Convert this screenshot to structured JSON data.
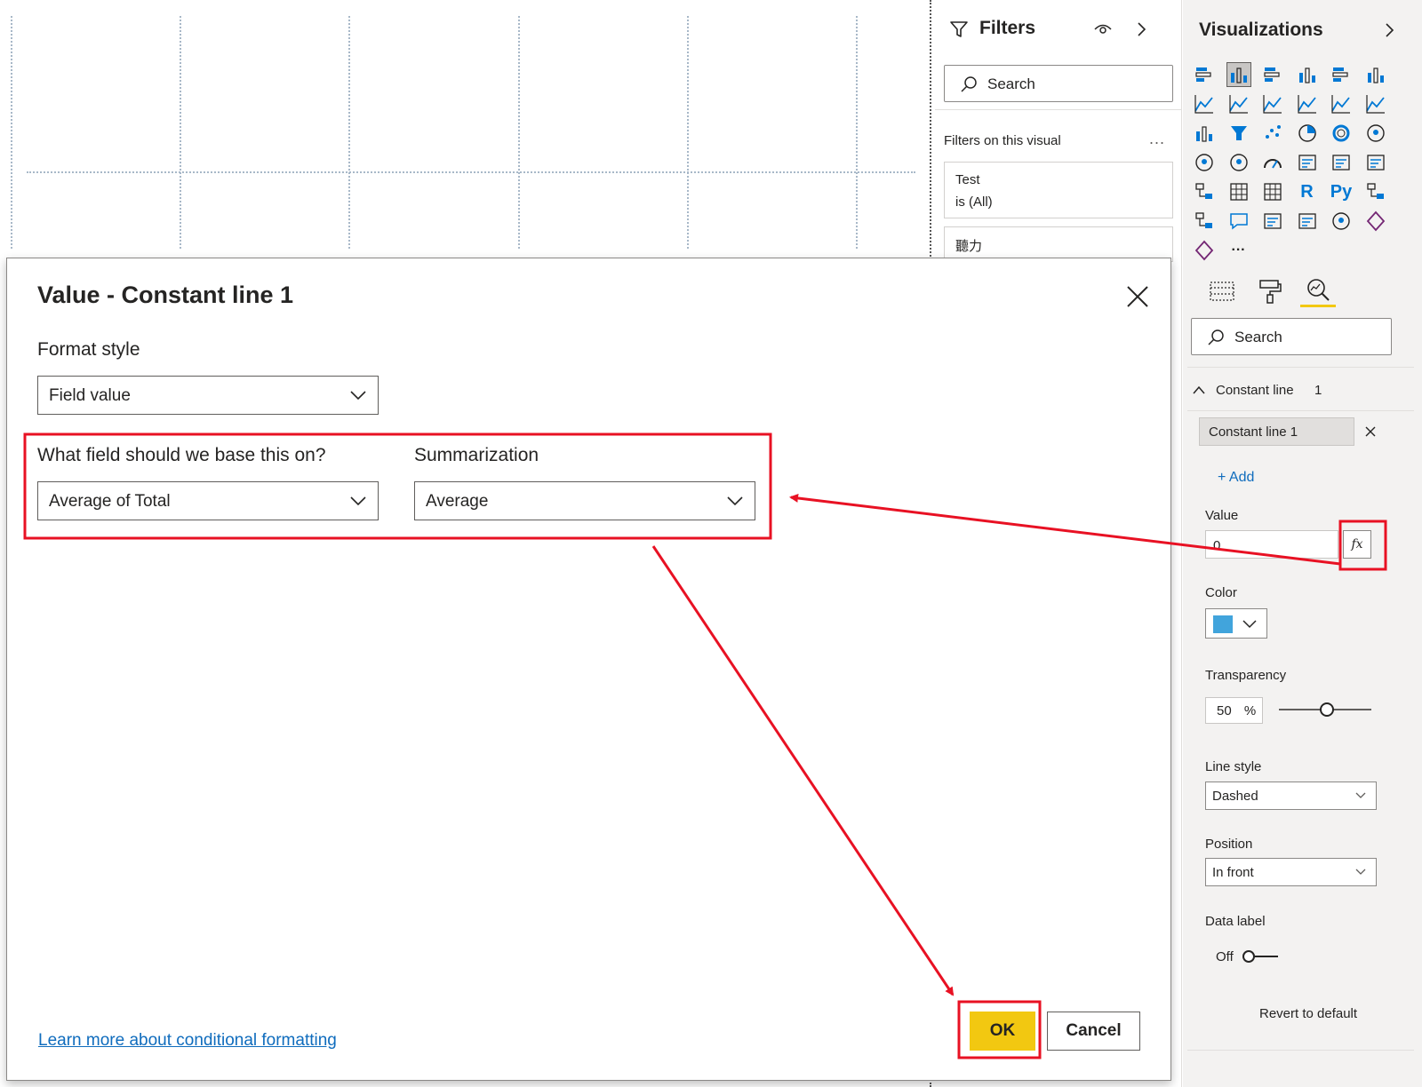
{
  "filters_pane": {
    "title": "Filters",
    "search_placeholder": "Search",
    "section_title": "Filters on this visual",
    "more": "...",
    "cards": [
      {
        "field": "Test",
        "state": "is (All)"
      },
      {
        "field": "聽力"
      }
    ]
  },
  "viz_pane": {
    "title": "Visualizations",
    "icons": [
      "stacked-bar-chart",
      "stacked-column-chart",
      "clustered-bar-chart",
      "clustered-column-chart",
      "100-stacked-bar-chart",
      "100-stacked-column-chart",
      "line-chart",
      "area-chart",
      "stacked-area-chart",
      "line-and-stacked-column-chart",
      "line-and-clustered-column-chart",
      "ribbon-chart",
      "waterfall-chart",
      "funnel-chart",
      "scatter-chart",
      "pie-chart",
      "donut-chart",
      "treemap",
      "map",
      "filled-map",
      "gauge",
      "card",
      "multi-row-card",
      "kpi",
      "slicer",
      "table",
      "matrix",
      "r-script-visual",
      "python-visual",
      "key-influencers",
      "decomposition-tree",
      "qna",
      "paginated-report",
      "smart-narrative",
      "arcgis-map",
      "power-apps",
      "power-automate",
      "more-visuals"
    ],
    "r_label": "R",
    "py_label": "Py",
    "more_label": "···",
    "search_placeholder": "Search",
    "section": {
      "title": "Constant line",
      "count": "1"
    },
    "line_name": "Constant line 1",
    "add_label": "+ Add",
    "value_label": "Value",
    "value": "0",
    "fx_label": "fx",
    "color_label": "Color",
    "line_color": "#41a4dc",
    "transparency_label": "Transparency",
    "transparency_value": "50",
    "transparency_unit": "%",
    "line_style_label": "Line style",
    "line_style_value": "Dashed",
    "position_label": "Position",
    "position_value": "In front",
    "data_label_label": "Data label",
    "data_label_state": "Off",
    "revert_label": "Revert to default"
  },
  "dialog": {
    "title": "Value - Constant line 1",
    "format_style_label": "Format style",
    "format_style_value": "Field value",
    "base_field_label": "What field should we base this on?",
    "base_field_value": "Average of Total",
    "summarization_label": "Summarization",
    "summarization_value": "Average",
    "learn_more": "Learn more about conditional formatting",
    "ok_label": "OK",
    "cancel_label": "Cancel"
  },
  "colors": {
    "accent_yellow": "#f2c811",
    "annotation_red": "#e81123",
    "link_blue": "#0f6cbd"
  }
}
